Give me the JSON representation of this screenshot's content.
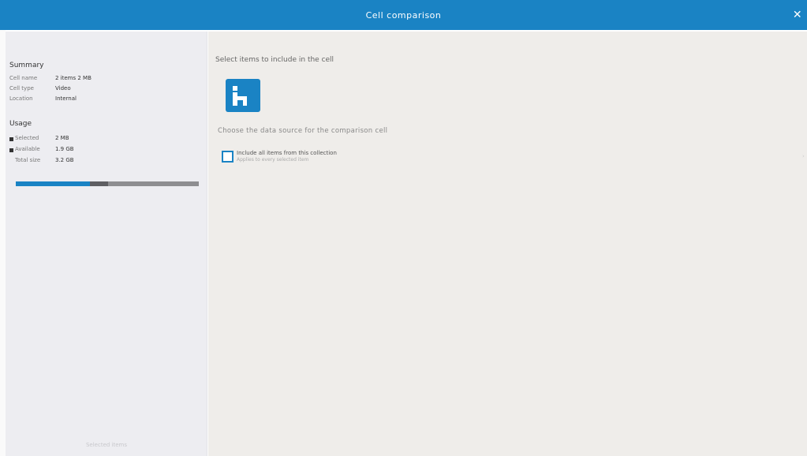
{
  "window": {
    "title": "Cell comparison",
    "close_icon": "close-icon"
  },
  "sidebar": {
    "summary": {
      "title": "Summary",
      "rows": [
        {
          "label": "Cell name",
          "value": "2 items 2 MB"
        },
        {
          "label": "Cell type",
          "value": "Video"
        },
        {
          "label": "Location",
          "value": "Internal"
        }
      ]
    },
    "storage": {
      "title": "Usage",
      "rows": [
        {
          "label": "Selected",
          "value": "2 MB"
        },
        {
          "label": "Available",
          "value": "1.9 GB"
        },
        {
          "label": "Total size",
          "value": "3.2 GB"
        }
      ],
      "used_fraction": 0.405,
      "other_fraction": 0.1
    },
    "footer": "Selected items"
  },
  "main": {
    "heading": "Select items to include in the cell",
    "app_icon": "cell-app-icon",
    "description": "Choose the data source for the comparison cell",
    "option": {
      "label": "Include all items from this collection",
      "sublabel": "Applies to every selected item",
      "checked": false
    }
  },
  "colors": {
    "accent": "#1a83c4",
    "sidebar_bg": "#ededf1",
    "main_bg": "#efedea"
  }
}
